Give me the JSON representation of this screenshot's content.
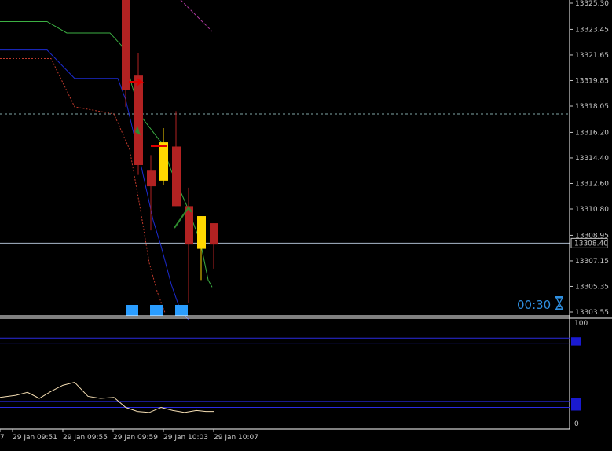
{
  "colors": {
    "background": "#000000",
    "bear_candle": "#b22222",
    "bull_candle": "#ffd700",
    "envelope_upper_green": "#3cb043",
    "envelope_blue": "#1c2bd0",
    "envelope_red_dotted": "#c0392b",
    "oscillator_line": "#f5deb3",
    "level_lines": "#2a2ae0",
    "marker_blue": "#2a9dff",
    "current_price_line": "#a9b8c9"
  },
  "timer": {
    "text": "00:30",
    "icon": "hourglass-icon"
  },
  "chart_data": [
    {
      "type": "candlestick",
      "title": "",
      "ylim": [
        13303.0,
        13325.8
      ],
      "y_ticks": [
        "13325.30",
        "13323.45",
        "13321.65",
        "13319.85",
        "13318.05",
        "13316.20",
        "13314.40",
        "13312.60",
        "13310.80",
        "13308.95",
        "13307.15",
        "13305.35",
        "13303.55"
      ],
      "current_price": {
        "value": 13308.4,
        "label": "13308.40"
      },
      "reference_level": 13317.5,
      "candles": [
        {
          "x": 160,
          "open": 13325.6,
          "close": 13319.2,
          "high": 13326.0,
          "low": 13318.0
        },
        {
          "x": 176,
          "open": 13320.2,
          "close": 13313.9,
          "high": 13321.8,
          "low": 13313.2
        },
        {
          "x": 192,
          "open": 13313.5,
          "close": 13312.4,
          "high": 13314.6,
          "low": 13309.3
        },
        {
          "x": 208,
          "open": 13312.8,
          "close": 13315.5,
          "high": 13316.5,
          "low": 13312.5
        },
        {
          "x": 224,
          "open": 13315.2,
          "close": 13311.0,
          "high": 13317.7,
          "low": 13311.0
        },
        {
          "x": 240,
          "open": 13311.0,
          "close": 13308.3,
          "high": 13312.3,
          "low": 13304.2
        },
        {
          "x": 256,
          "open": 13308.0,
          "close": 13310.3,
          "high": 13310.3,
          "low": 13305.8
        },
        {
          "x": 272,
          "open": 13309.8,
          "close": 13308.3,
          "high": 13309.8,
          "low": 13306.6
        }
      ],
      "envelope_green": [
        [
          0,
          13324.0
        ],
        [
          60,
          13324.0
        ],
        [
          85,
          13323.2
        ],
        [
          140,
          13323.2
        ],
        [
          155,
          13322.3
        ],
        [
          168,
          13319.5
        ],
        [
          180,
          13317.3
        ],
        [
          205,
          13315.5
        ],
        [
          218,
          13313.5
        ],
        [
          238,
          13311.0
        ],
        [
          255,
          13308.5
        ],
        [
          265,
          13305.8
        ],
        [
          270,
          13305.3
        ]
      ],
      "envelope_blue": [
        [
          0,
          13322.0
        ],
        [
          60,
          13322.0
        ],
        [
          95,
          13320.0
        ],
        [
          150,
          13320.0
        ],
        [
          160,
          13318.5
        ],
        [
          175,
          13315.0
        ],
        [
          195,
          13310.0
        ],
        [
          205,
          13308.2
        ],
        [
          218,
          13305.5
        ],
        [
          230,
          13303.6
        ],
        [
          240,
          13303.0
        ]
      ],
      "envelope_red": [
        [
          0,
          13321.4
        ],
        [
          65,
          13321.4
        ],
        [
          95,
          13318.0
        ],
        [
          145,
          13317.5
        ],
        [
          165,
          13315.0
        ],
        [
          178,
          13311.0
        ],
        [
          190,
          13307.0
        ],
        [
          200,
          13305.0
        ],
        [
          210,
          13303.5
        ]
      ],
      "markers": [
        {
          "x": 168,
          "kind": "blue-square"
        },
        {
          "x": 199,
          "kind": "blue-square"
        },
        {
          "x": 231,
          "kind": "blue-square"
        }
      ]
    },
    {
      "type": "line",
      "title": "",
      "ylim": [
        0,
        100
      ],
      "y_ticks": [
        "100",
        "0"
      ],
      "levels": [
        85,
        80,
        22,
        16
      ],
      "values": [
        [
          0,
          26
        ],
        [
          20,
          28
        ],
        [
          35,
          31
        ],
        [
          50,
          25
        ],
        [
          65,
          32
        ],
        [
          80,
          38
        ],
        [
          95,
          41
        ],
        [
          112,
          27
        ],
        [
          128,
          25
        ],
        [
          145,
          26
        ],
        [
          160,
          16
        ],
        [
          175,
          12
        ],
        [
          190,
          11
        ],
        [
          205,
          16
        ],
        [
          220,
          13
        ],
        [
          235,
          11
        ],
        [
          250,
          13
        ],
        [
          262,
          12
        ],
        [
          272,
          12
        ]
      ]
    }
  ],
  "x_ticks": [
    "7",
    "29 Jan 09:51",
    "29 Jan 09:55",
    "29 Jan 09:59",
    "29 Jan 10:03",
    "29 Jan 10:07"
  ]
}
